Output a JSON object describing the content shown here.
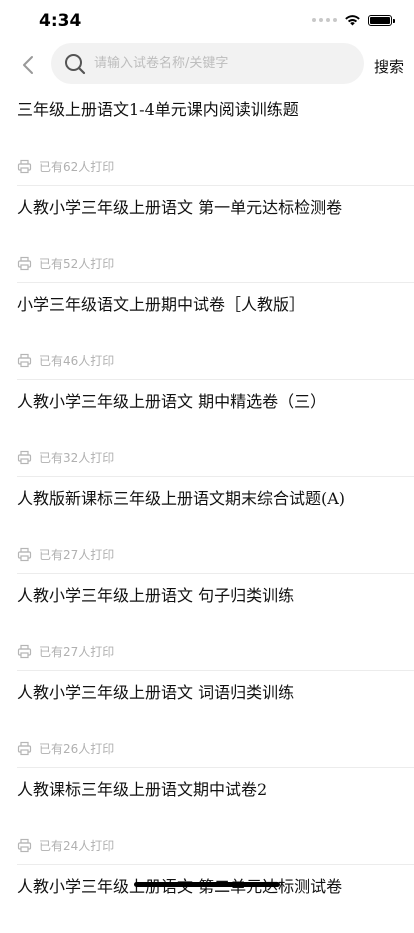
{
  "status_bar": {
    "time": "4:34"
  },
  "search": {
    "placeholder": "请输入试卷名称/关键字",
    "button_label": "搜索"
  },
  "first_item_title": "三年级上册语文1-4单元课内阅读训练题",
  "items": [
    {
      "print_count": "已有62人打印",
      "next_title": "人教小学三年级上册语文 第一单元达标检测卷"
    },
    {
      "print_count": "已有52人打印",
      "next_title": "小学三年级语文上册期中试卷［人教版］"
    },
    {
      "print_count": "已有46人打印",
      "next_title": "人教小学三年级上册语文 期中精选卷（三）"
    },
    {
      "print_count": "已有32人打印",
      "next_title": "人教版新课标三年级上册语文期末综合试题(A)"
    },
    {
      "print_count": "已有27人打印",
      "next_title": "人教小学三年级上册语文 句子归类训练"
    },
    {
      "print_count": "已有27人打印",
      "next_title": "人教小学三年级上册语文 词语归类训练"
    },
    {
      "print_count": "已有26人打印",
      "next_title": "人教课标三年级上册语文期中试卷2"
    },
    {
      "print_count": "已有24人打印",
      "next_title": "人教小学三年级上册语文 第二单元达标测试卷"
    }
  ]
}
